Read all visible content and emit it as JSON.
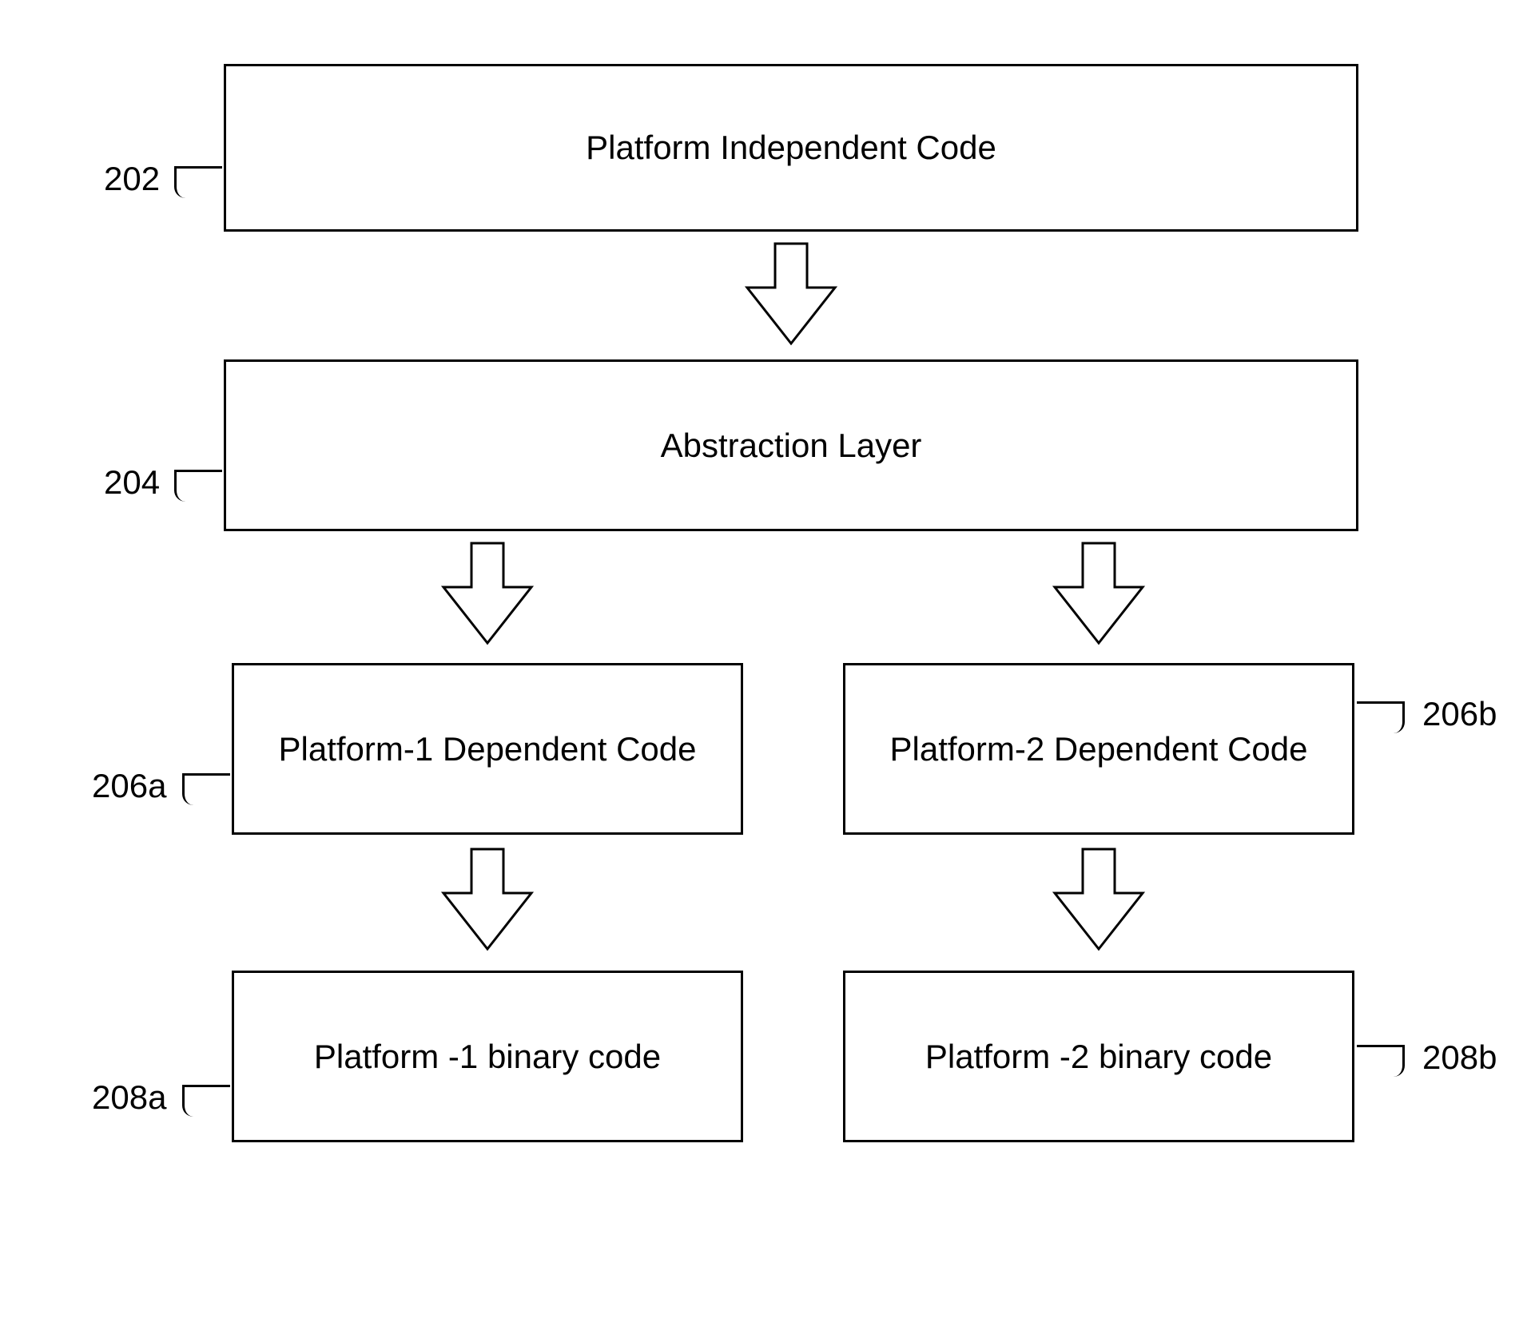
{
  "boxes": {
    "b202": {
      "label": "Platform Independent Code",
      "ref": "202"
    },
    "b204": {
      "label": "Abstraction Layer",
      "ref": "204"
    },
    "b206a": {
      "label": "Platform-1 Dependent Code",
      "ref": "206a"
    },
    "b206b": {
      "label": "Platform-2 Dependent Code",
      "ref": "206b"
    },
    "b208a": {
      "label": "Platform -1 binary code",
      "ref": "208a"
    },
    "b208b": {
      "label": "Platform -2 binary code",
      "ref": "208b"
    }
  }
}
